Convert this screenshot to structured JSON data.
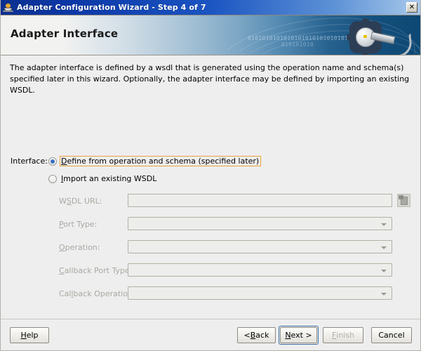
{
  "window": {
    "title": "Adapter Configuration Wizard - Step 4 of 7",
    "icon": "java-cup-icon",
    "close_label": "✕"
  },
  "banner": {
    "heading": "Adapter Interface",
    "binary_row1": "0101010101010101010101010101",
    "binary_row2": "010101010"
  },
  "content": {
    "description": "The adapter interface is defined by a wsdl that is generated using the operation name and schema(s) specified later in this wizard.  Optionally, the adapter interface may be defined by importing an existing WSDL.",
    "interface_label": "Interface:",
    "radios": [
      {
        "mnemonic": "D",
        "rest": "efine from operation and schema (specified later)",
        "selected": true,
        "focused": true
      },
      {
        "mnemonic": "I",
        "rest": "mport an existing WSDL",
        "selected": false,
        "focused": false
      }
    ],
    "fields": [
      {
        "label_pre": "W",
        "label_mn": "S",
        "label_post": "DL URL:",
        "type": "text",
        "value": "",
        "disabled": true
      },
      {
        "label_pre": "",
        "label_mn": "P",
        "label_post": "ort Type:",
        "type": "combo",
        "value": "",
        "disabled": true
      },
      {
        "label_pre": "",
        "label_mn": "O",
        "label_post": "peration:",
        "type": "combo",
        "value": "",
        "disabled": true
      },
      {
        "label_pre": "",
        "label_mn": "C",
        "label_post": "allback Port Type:",
        "type": "combo",
        "value": "",
        "disabled": true
      },
      {
        "label_pre": "Cal",
        "label_mn": "l",
        "label_post": "back Operation:",
        "type": "combo",
        "value": "",
        "disabled": true
      }
    ],
    "browse_button_icon": "document-browse-icon"
  },
  "buttons": {
    "help": {
      "mn": "H",
      "rest": "elp",
      "disabled": false
    },
    "back": {
      "pre": "< ",
      "mn": "B",
      "rest": "ack",
      "disabled": false
    },
    "next": {
      "mn": "N",
      "rest": "ext >",
      "disabled": false,
      "is_default": true
    },
    "finish": {
      "mn": "F",
      "rest": "inish",
      "disabled": true
    },
    "cancel": {
      "mn": "",
      "rest": "Cancel",
      "disabled": false
    }
  },
  "colors": {
    "titlebar_start": "#0b2f8f",
    "titlebar_end": "#a8c8ea",
    "panel_bg": "#eeeeee",
    "focus_orange": "#e8a33d",
    "default_button_blue": "#3b6ea5",
    "radio_dot_blue": "#3a6fbf",
    "disabled_text": "#a8a8a2"
  }
}
